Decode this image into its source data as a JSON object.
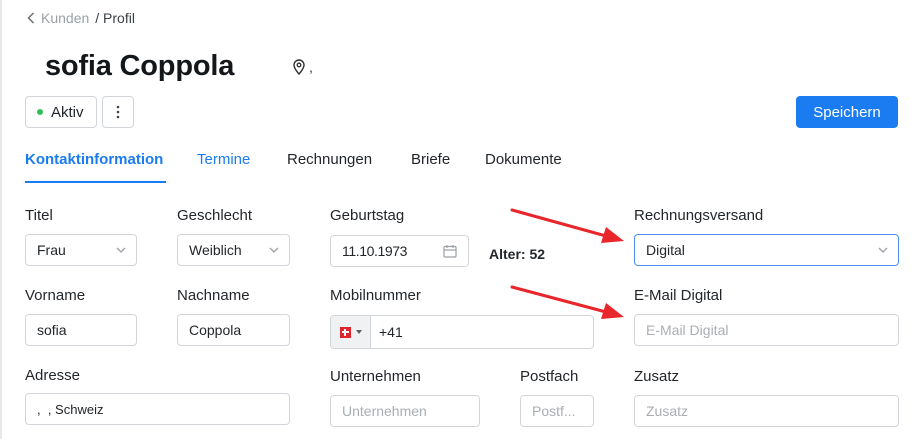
{
  "breadcrumb": {
    "back": "Kunden",
    "current": "/ Profil"
  },
  "customer": {
    "name": "sofia Coppola",
    "location": ","
  },
  "status": {
    "label": "Aktiv",
    "color": "#2fbf5b"
  },
  "actions": {
    "save": "Speichern"
  },
  "tabs": [
    {
      "label": "Kontaktinformation"
    },
    {
      "label": "Termine"
    },
    {
      "label": "Rechnungen"
    },
    {
      "label": "Briefe"
    },
    {
      "label": "Dokumente"
    }
  ],
  "form": {
    "titel": {
      "label": "Titel",
      "value": "Frau"
    },
    "geschlecht": {
      "label": "Geschlecht",
      "value": "Weiblich"
    },
    "geburtstag": {
      "label": "Geburtstag",
      "value": "11.10.1973"
    },
    "alter": "Alter: 52",
    "rechnungsversand": {
      "label": "Rechnungsversand",
      "value": "Digital"
    },
    "vorname": {
      "label": "Vorname",
      "value": "sofia"
    },
    "nachname": {
      "label": "Nachname",
      "value": "Coppola"
    },
    "mobilnummer": {
      "label": "Mobilnummer",
      "value": "+41",
      "country": "Schweiz"
    },
    "email_digital": {
      "label": "E-Mail Digital",
      "placeholder": "E-Mail Digital"
    },
    "adresse": {
      "label": "Adresse",
      "value": ",  , Schweiz"
    },
    "unternehmen": {
      "label": "Unternehmen",
      "placeholder": "Unternehmen"
    },
    "postfach": {
      "label": "Postfach",
      "placeholder": "Postf..."
    },
    "zusatz": {
      "label": "Zusatz",
      "placeholder": "Zusatz"
    }
  },
  "colors": {
    "accent": "#1a7cf0",
    "arrow": "#e8262b",
    "active_dot": "#2fbf5b"
  }
}
